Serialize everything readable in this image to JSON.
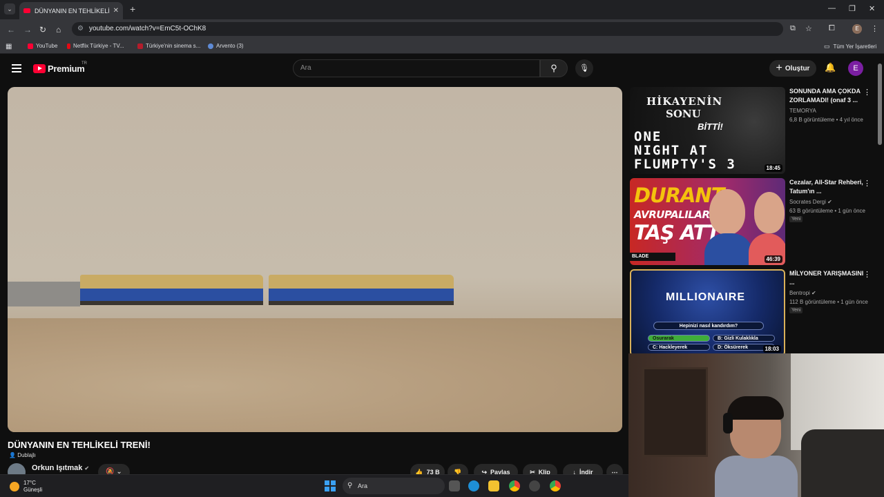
{
  "browser": {
    "tab_title": "DÜNYANIN EN TEHLİKELİ TRENİ",
    "url": "youtube.com/watch?v=EmC5t-OChK8",
    "bookmarks": [
      {
        "label": "YouTube",
        "color": "#ff0033"
      },
      {
        "label": "Netflix Türkiye - TV...",
        "color": "#e50914"
      },
      {
        "label": "Türkiye'nin sinema s...",
        "color": "#b41c2b"
      },
      {
        "label": "Arvento (3)",
        "color": "#5f8bd6"
      }
    ],
    "all_bookmarks": "Tüm Yer İşaretleri",
    "profile_initial": "E"
  },
  "header": {
    "logo_text": "Premium",
    "logo_region": "TR",
    "search_placeholder": "Ara",
    "create_label": "Oluştur",
    "avatar_initial": "E"
  },
  "video": {
    "title": "DÜNYANIN EN TEHLİKELİ TRENİ!",
    "dub_label": "Dublajlı",
    "channel_name": "Orkun Işıtmak",
    "likes": "73 B",
    "share_label": "Paylaş",
    "clip_label": "Klip",
    "download_label": "İndir"
  },
  "recommendations": [
    {
      "title": "SONUNDA AMA ÇOKDA ZORLAMADI! (onaf 3 ...",
      "channel": "TEMORYA",
      "meta": "6,8 B görüntüleme • 4 yıl önce",
      "duration": "18:45",
      "thumb_text": [
        "HİKAYENİN",
        "SONU",
        "BİTTİ!",
        "ONE",
        "NIGHT AT",
        "FLUMPTY'S 3"
      ]
    },
    {
      "title": "Cezalar, All-Star Rehberi, Tatum'ın ...",
      "channel": "Socrates Dergi",
      "meta": "63 B görüntüleme • 1 gün önce",
      "badge": "Yeni",
      "duration": "46:39",
      "thumb_text": [
        "DURANT",
        "AVRUPALILARA",
        "TAŞ ATTI",
        "BLADE"
      ]
    },
    {
      "title": "MİLYONER YARIŞMASINI ...",
      "channel": "Bentropi",
      "meta": "112 B görüntüleme • 1 gün önce",
      "badge": "Yeni",
      "duration": "18:03",
      "thumb_text": [
        "MILLIONAIRE",
        "Hepinizi nasıl kandırdım?",
        "Osurarak",
        "B: Gizli Kulaklıkla",
        "C: Hackleyerek",
        "D: Öksürerek"
      ]
    }
  ],
  "taskbar": {
    "temperature": "17°C",
    "weather": "Güneşli",
    "search_label": "Ara"
  }
}
